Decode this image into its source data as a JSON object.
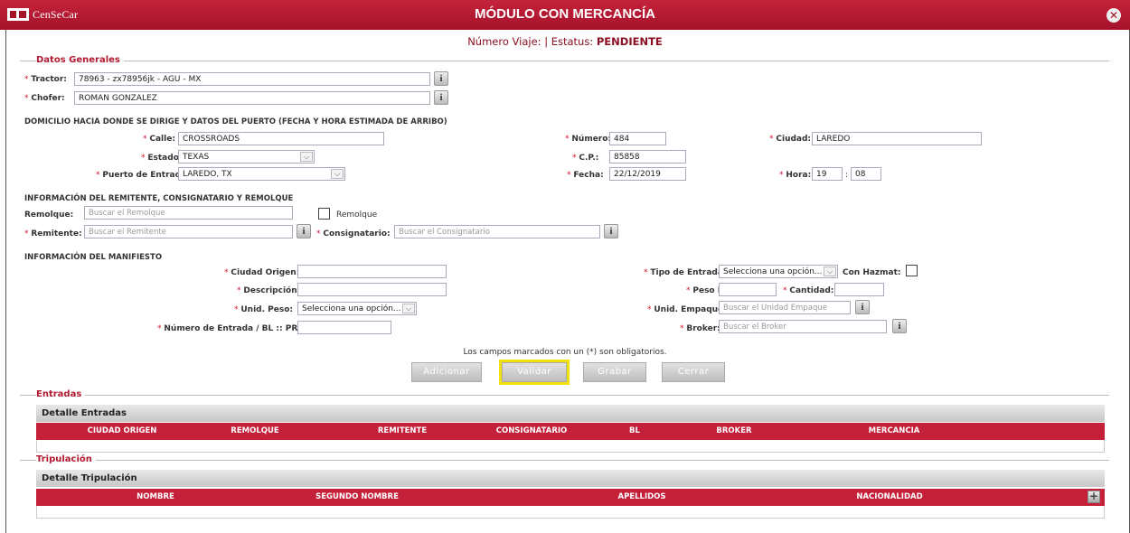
{
  "window": {
    "app_name": "CenSeCar",
    "title": "MÓDULO CON MERCANCÍA",
    "trip_label": "Número Viaje:",
    "status_label": "Estatus:",
    "status_value": "PENDIENTE"
  },
  "general": {
    "section_title": "Datos Generales",
    "tractor_label": "Tractor:",
    "tractor_value": "78963 - zx78956jk - AGU - MX",
    "driver_label": "Chofer:",
    "driver_value": "ROMAN  GONZALEZ"
  },
  "address": {
    "heading": "DOMICILIO HACIA DONDE SE DIRIGE Y DATOS DEL PUERTO (FECHA Y HORA ESTIMADA DE ARRIBO)",
    "street_label": "Calle:",
    "street_value": "CROSSROADS",
    "number_label": "Número:",
    "number_value": "484",
    "city_label": "Ciudad:",
    "city_value": "LAREDO",
    "state_label": "Estado:",
    "state_value": "TEXAS",
    "zip_label": "C.P.:",
    "zip_value": "85858",
    "port_label": "Puerto de Entrada:",
    "port_value": "LAREDO, TX",
    "date_label": "Fecha:",
    "date_value": "22/12/2019",
    "time_label": "Hora:",
    "hour_value": "19",
    "minute_value": "08"
  },
  "sender": {
    "heading": "INFORMACIÓN DEL REMITENTE, CONSIGNATARIO Y REMOLQUE",
    "trailer_label": "Remolque:",
    "trailer_placeholder": "Buscar el Remolque",
    "trailer_check_label": "Remolque",
    "sender_label": "Remitente:",
    "sender_placeholder": "Buscar el Remitente",
    "consignee_label": "Consignatario:",
    "consignee_placeholder": "Buscar el Consignatario"
  },
  "manifest": {
    "heading": "INFORMACIÓN DEL MANIFIESTO",
    "origin_label": "Ciudad Origen:",
    "description_label": "Descripción:",
    "weight_unit_label": "Unid. Peso:",
    "weight_unit_value": "Selecciona una opción...",
    "entry_number_label": "Número de Entrada / BL :: PRLM:",
    "entry_type_label": "Tipo de Entrada:",
    "entry_type_value": "Selecciona una opción...",
    "hazmat_label": "Con Hazmat:",
    "net_weight_label": "Peso Net.:",
    "quantity_label": "Cantidad:",
    "package_unit_label": "Unid. Empaque:",
    "package_unit_placeholder": "Buscar el Unidad Empaque",
    "broker_label": "Broker:",
    "broker_placeholder": "Buscar el Broker"
  },
  "required_note": "Los campos marcados con un (*) son obligatorios.",
  "buttons": {
    "add": "Adicionar",
    "validate": "Validar",
    "save": "Grabar",
    "close": "Cerrar"
  },
  "entries": {
    "section_title": "Entradas",
    "grid_title": "Detalle Entradas",
    "columns": [
      "CIUDAD ORIGEN",
      "REMOLQUE",
      "REMITENTE",
      "CONSIGNATARIO",
      "BL",
      "BROKER",
      "MERCANCIA"
    ]
  },
  "crew": {
    "section_title": "Tripulación",
    "grid_title": "Detalle Tripulación",
    "columns": [
      "NOMBRE",
      "SEGUNDO NOMBRE",
      "APELLIDOS",
      "NACIONALIDAD"
    ]
  },
  "colors": {
    "brand": "#b11a30",
    "highlight": "#f0e10a"
  },
  "icons": [
    "info-icon",
    "close-icon",
    "chevron-down-icon",
    "plus-icon"
  ]
}
